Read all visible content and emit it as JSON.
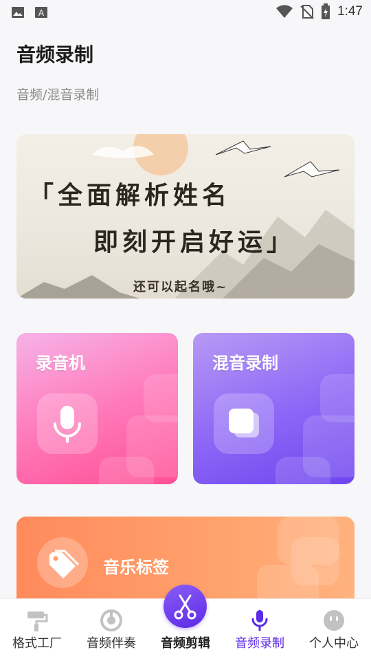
{
  "status_bar": {
    "time": "1:47",
    "left_icons": [
      "image-icon",
      "font-icon"
    ],
    "right_icons": [
      "wifi-icon",
      "no-sim-icon",
      "battery-charging-icon"
    ]
  },
  "header": {
    "title": "音频录制",
    "subtitle": "音频/混音录制"
  },
  "banner": {
    "line1": "「全面解析姓名",
    "line2": "即刻开启好运」",
    "line3": "还可以起名哦~"
  },
  "cards": [
    {
      "label": "录音机",
      "icon": "microphone-icon"
    },
    {
      "label": "混音录制",
      "icon": "stop-square-icon"
    },
    {
      "label": "音乐标签",
      "icon": "tag-icon"
    }
  ],
  "tabs": [
    {
      "label": "格式工厂",
      "icon": "paint-roller-icon",
      "active": false
    },
    {
      "label": "音频伴奏",
      "icon": "power-dial-icon",
      "active": false
    },
    {
      "label": "音频剪辑",
      "icon": "scissors-icon",
      "active": false
    },
    {
      "label": "音频录制",
      "icon": "microphone-icon",
      "active": true
    },
    {
      "label": "个人中心",
      "icon": "face-icon",
      "active": false
    }
  ],
  "colors": {
    "accent": "#5b2be8",
    "active_tab": "#5b2be8",
    "recorder_card": "#ff5b9c",
    "mix_card": "#7a52f2",
    "tags_card": "#ff9a66"
  }
}
